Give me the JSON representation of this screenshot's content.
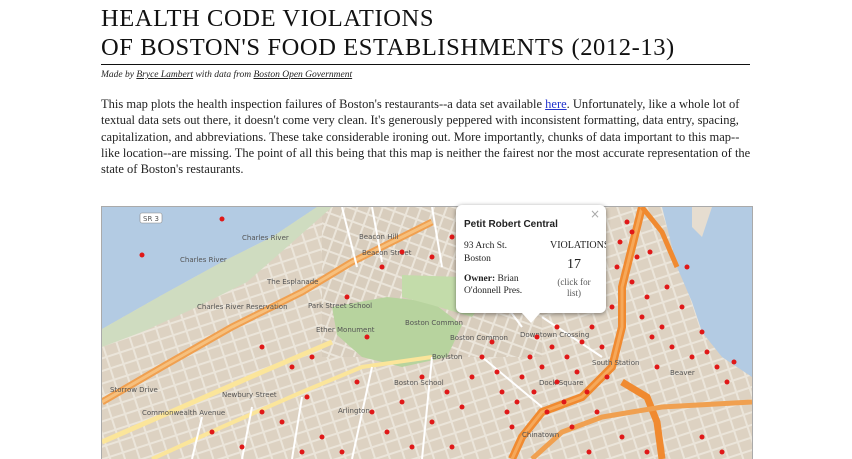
{
  "header": {
    "title_line1": "HEALTH CODE VIOLATIONS",
    "title_line2": "OF BOSTON'S FOOD ESTABLISHMENTS (2012-13)"
  },
  "credit": {
    "made_by": "Made by",
    "author": "Bryce Lambert",
    "with_data_from": "with data from",
    "source": "Boston Open Government"
  },
  "intro": {
    "text_before_link": "This map plots the health inspection failures of Boston's restaurants--a data set available ",
    "link": "here",
    "text_after_link": ". Unfortunately, like a whole lot of textual data sets out there, it doesn't come very clean. It's generously peppered with inconsistent formatting, data entry, spacing, capitalization, and abbreviations. These take considerable ironing out. More importantly, chunks of data important to this map--like location--are missing. The point of all this being that this map is neither the fairest nor the most accurate representation of the state of Boston's restaurants."
  },
  "popup": {
    "close": "×",
    "name": "Petit Robert Central",
    "address_line1": "93 Arch St.",
    "address_line2": "Boston",
    "owner_label": "Owner:",
    "owner_name": "Brian O'donnell Pres.",
    "violations_label": "VIOLATIONS",
    "violations_count": "17",
    "click_hint": "(click for list)"
  },
  "map": {
    "labels": {
      "charles_river_1": "Charles River",
      "charles_river_2": "Charles River",
      "charles_river_reservation": "Charles River Reservation",
      "esplanade": "The Esplanade",
      "park_street_school": "Park Street School",
      "ether_monument": "Ether Monument",
      "boston_common_1": "Boston Common",
      "boston_common_2": "Boston Common",
      "beacon_hill": "Beacon Hill",
      "beacon_street": "Beacon Street",
      "boylston": "Boylston",
      "boston_school": "Boston School",
      "chinatown": "Chinatown",
      "dock_square": "Dock Square",
      "south_station": "South Station",
      "beaver": "Beaver",
      "sr3": "SR 3",
      "commonwealth_avenue": "Commonwealth Avenue",
      "newbury_street": "Newbury Street",
      "storrow_drive": "Storrow Drive",
      "arlington": "Arlington",
      "downtown_crossing": "Downtown Crossing"
    }
  }
}
